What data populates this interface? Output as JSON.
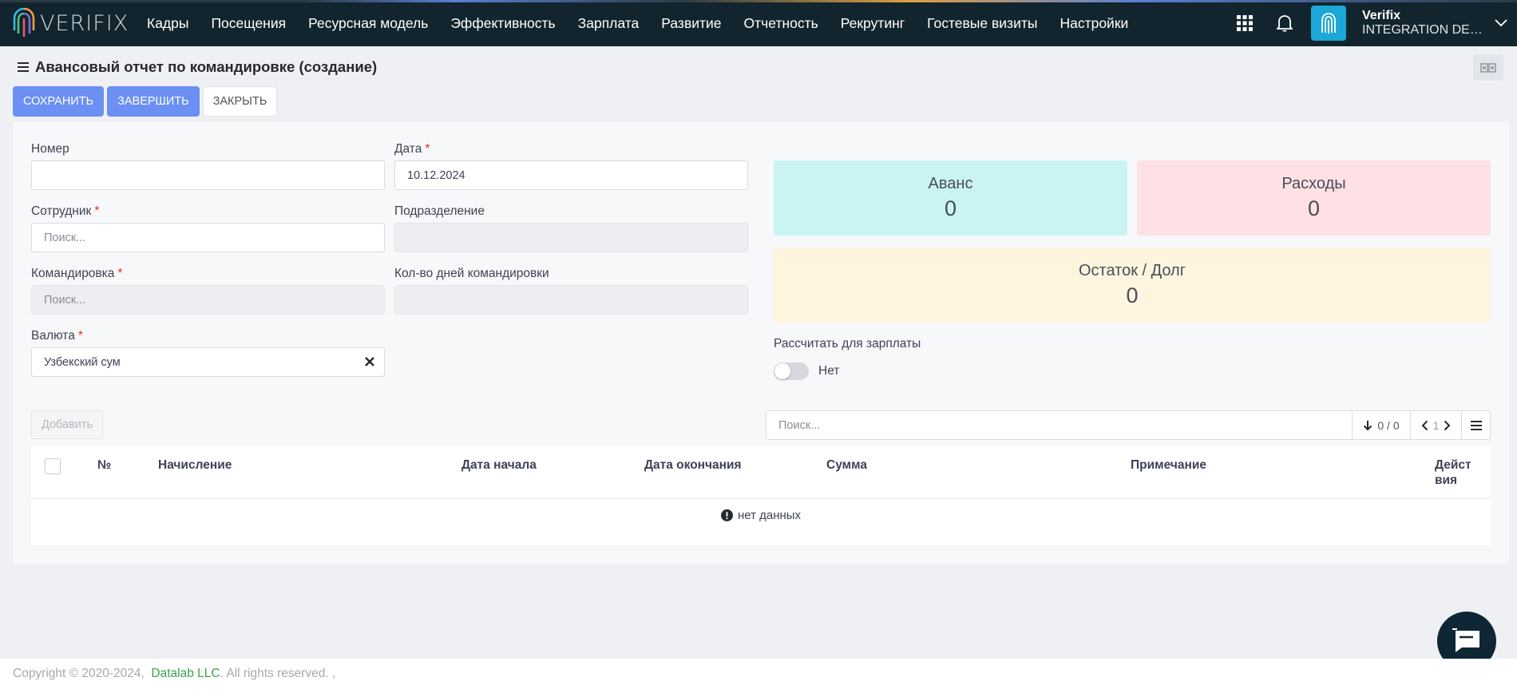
{
  "app": {
    "logo_text": "VERIFIX",
    "nav": [
      "Кадры",
      "Посещения",
      "Ресурсная модель",
      "Эффективность",
      "Зарплата",
      "Развитие",
      "Отчетность",
      "Рекрутинг",
      "Гостевые визиты",
      "Настройки"
    ],
    "user": {
      "name": "Verifix",
      "department": "INTEGRATION DEPARTMENT"
    },
    "icons": {
      "apps": "grid-icon",
      "notifications": "bell-icon",
      "avatar": "fingerprint-icon",
      "user_menu": "chevron-down-icon"
    }
  },
  "page": {
    "title": "Авансовый отчет по командировке (создание)",
    "menu_icon": "hamburger-icon",
    "corner_icon": "layout-toggle-icon"
  },
  "actions": {
    "save": "СОХРАНИТЬ",
    "complete": "ЗАВЕРШИТЬ",
    "close": "ЗАКРЫТЬ"
  },
  "form": {
    "number": {
      "label": "Номер",
      "value": ""
    },
    "date": {
      "label": "Дата",
      "value": "10.12.2024",
      "required_mark": "*"
    },
    "employee": {
      "label": "Сотрудник",
      "placeholder": "Поиск...",
      "required_mark": "*"
    },
    "division": {
      "label": "Подразделение",
      "value": ""
    },
    "trip": {
      "label": "Командировка",
      "placeholder": "Поиск...",
      "required_mark": "*"
    },
    "trip_days": {
      "label": "Кол-во дней командировки",
      "value": ""
    },
    "currency": {
      "label": "Валюта",
      "value": "Узбекский сум",
      "required_mark": "*"
    }
  },
  "summary": {
    "advance": {
      "label": "Аванс",
      "value": "0"
    },
    "expenses": {
      "label": "Расходы",
      "value": "0"
    },
    "balance": {
      "label": "Остаток / Долг",
      "value": "0"
    },
    "colors": {
      "advance": "#c9f4f3",
      "expenses": "#fde1e4",
      "balance": "#fff5df"
    }
  },
  "payroll": {
    "label": "Рассчитать для зарплаты",
    "toggle_text": "Нет",
    "enabled": false
  },
  "grid": {
    "add_label": "Добавить",
    "search_placeholder": "Поиск...",
    "count_text": "0 / 0",
    "page_text": "1",
    "columns": [
      "№",
      "Начисление",
      "Дата начала",
      "Дата окончания",
      "Сумма",
      "Примечание",
      "Действия"
    ],
    "rows": [],
    "empty_text": "нет данных"
  },
  "footer": {
    "copyright": "Copyright © 2020-2024,  ",
    "company": "Datalab LLC",
    "rights": ". All rights reserved. ,"
  }
}
